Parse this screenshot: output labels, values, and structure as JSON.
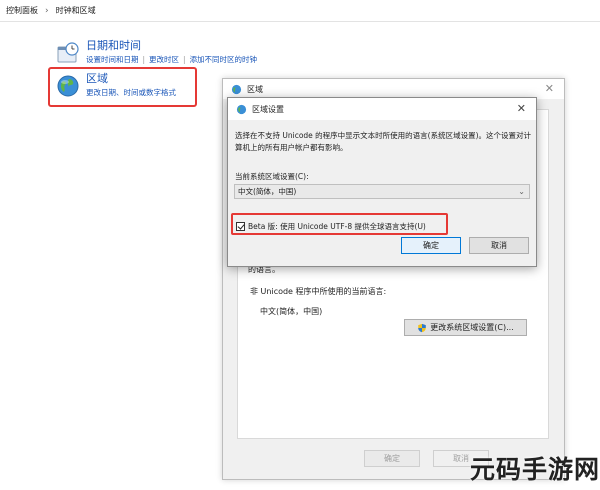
{
  "breadcrumb": {
    "root": "控制面板",
    "current": "时钟和区域"
  },
  "datetime": {
    "title": "日期和时间",
    "links": [
      "设置时间和日期",
      "更改时区",
      "添加不同时区的时钟"
    ]
  },
  "region_item": {
    "title": "区域",
    "subtitle": "更改日期、时间或数字格式"
  },
  "region_window": {
    "title": "区域",
    "partial_text": "的语言。",
    "unicode_label": "非 Unicode 程序中所使用的当前语言:",
    "unicode_value": "中文(简体，中国)",
    "change_locale_button": "更改系统区域设置(C)...",
    "ok_button": "确定",
    "cancel_button": "取消"
  },
  "dialog": {
    "title": "区域设置",
    "description": "选择在不支持 Unicode 的程序中显示文本时所使用的语言(系统区域设置)。这个设置对计算机上的所有用户帐户都有影响。",
    "locale_label": "当前系统区域设置(C):",
    "locale_value": "中文(简体，中国)",
    "beta_checkbox_label": "Beta 版: 使用 Unicode UTF-8 提供全球语言支持(U)",
    "beta_checked": true,
    "ok_button": "确定",
    "cancel_button": "取消"
  },
  "watermark": "元码手游网",
  "colors": {
    "link": "#1a56b8",
    "highlight_box": "#e53935",
    "primary_button_border": "#0078d7"
  }
}
